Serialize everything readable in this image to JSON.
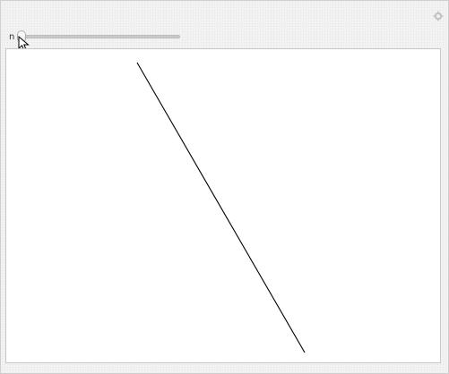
{
  "controls": {
    "n_label": "n",
    "n_slider_fraction": 0.0
  },
  "icons": {
    "settings": "gear-icon",
    "cursor": "mouse-pointer-icon"
  },
  "colors": {
    "line": "#000000",
    "background": "#f2f2f2"
  }
}
